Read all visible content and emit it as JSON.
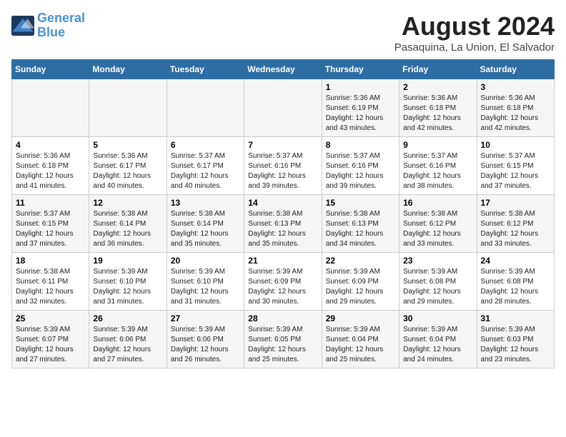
{
  "header": {
    "logo_line1": "General",
    "logo_line2": "Blue",
    "month_year": "August 2024",
    "location": "Pasaquina, La Union, El Salvador"
  },
  "days_of_week": [
    "Sunday",
    "Monday",
    "Tuesday",
    "Wednesday",
    "Thursday",
    "Friday",
    "Saturday"
  ],
  "weeks": [
    [
      {
        "day": "",
        "info": ""
      },
      {
        "day": "",
        "info": ""
      },
      {
        "day": "",
        "info": ""
      },
      {
        "day": "",
        "info": ""
      },
      {
        "day": "1",
        "info": "Sunrise: 5:36 AM\nSunset: 6:19 PM\nDaylight: 12 hours\nand 43 minutes."
      },
      {
        "day": "2",
        "info": "Sunrise: 5:36 AM\nSunset: 6:18 PM\nDaylight: 12 hours\nand 42 minutes."
      },
      {
        "day": "3",
        "info": "Sunrise: 5:36 AM\nSunset: 6:18 PM\nDaylight: 12 hours\nand 42 minutes."
      }
    ],
    [
      {
        "day": "4",
        "info": "Sunrise: 5:36 AM\nSunset: 6:18 PM\nDaylight: 12 hours\nand 41 minutes."
      },
      {
        "day": "5",
        "info": "Sunrise: 5:36 AM\nSunset: 6:17 PM\nDaylight: 12 hours\nand 40 minutes."
      },
      {
        "day": "6",
        "info": "Sunrise: 5:37 AM\nSunset: 6:17 PM\nDaylight: 12 hours\nand 40 minutes."
      },
      {
        "day": "7",
        "info": "Sunrise: 5:37 AM\nSunset: 6:16 PM\nDaylight: 12 hours\nand 39 minutes."
      },
      {
        "day": "8",
        "info": "Sunrise: 5:37 AM\nSunset: 6:16 PM\nDaylight: 12 hours\nand 39 minutes."
      },
      {
        "day": "9",
        "info": "Sunrise: 5:37 AM\nSunset: 6:16 PM\nDaylight: 12 hours\nand 38 minutes."
      },
      {
        "day": "10",
        "info": "Sunrise: 5:37 AM\nSunset: 6:15 PM\nDaylight: 12 hours\nand 37 minutes."
      }
    ],
    [
      {
        "day": "11",
        "info": "Sunrise: 5:37 AM\nSunset: 6:15 PM\nDaylight: 12 hours\nand 37 minutes."
      },
      {
        "day": "12",
        "info": "Sunrise: 5:38 AM\nSunset: 6:14 PM\nDaylight: 12 hours\nand 36 minutes."
      },
      {
        "day": "13",
        "info": "Sunrise: 5:38 AM\nSunset: 6:14 PM\nDaylight: 12 hours\nand 35 minutes."
      },
      {
        "day": "14",
        "info": "Sunrise: 5:38 AM\nSunset: 6:13 PM\nDaylight: 12 hours\nand 35 minutes."
      },
      {
        "day": "15",
        "info": "Sunrise: 5:38 AM\nSunset: 6:13 PM\nDaylight: 12 hours\nand 34 minutes."
      },
      {
        "day": "16",
        "info": "Sunrise: 5:38 AM\nSunset: 6:12 PM\nDaylight: 12 hours\nand 33 minutes."
      },
      {
        "day": "17",
        "info": "Sunrise: 5:38 AM\nSunset: 6:12 PM\nDaylight: 12 hours\nand 33 minutes."
      }
    ],
    [
      {
        "day": "18",
        "info": "Sunrise: 5:38 AM\nSunset: 6:11 PM\nDaylight: 12 hours\nand 32 minutes."
      },
      {
        "day": "19",
        "info": "Sunrise: 5:39 AM\nSunset: 6:10 PM\nDaylight: 12 hours\nand 31 minutes."
      },
      {
        "day": "20",
        "info": "Sunrise: 5:39 AM\nSunset: 6:10 PM\nDaylight: 12 hours\nand 31 minutes."
      },
      {
        "day": "21",
        "info": "Sunrise: 5:39 AM\nSunset: 6:09 PM\nDaylight: 12 hours\nand 30 minutes."
      },
      {
        "day": "22",
        "info": "Sunrise: 5:39 AM\nSunset: 6:09 PM\nDaylight: 12 hours\nand 29 minutes."
      },
      {
        "day": "23",
        "info": "Sunrise: 5:39 AM\nSunset: 6:08 PM\nDaylight: 12 hours\nand 29 minutes."
      },
      {
        "day": "24",
        "info": "Sunrise: 5:39 AM\nSunset: 6:08 PM\nDaylight: 12 hours\nand 28 minutes."
      }
    ],
    [
      {
        "day": "25",
        "info": "Sunrise: 5:39 AM\nSunset: 6:07 PM\nDaylight: 12 hours\nand 27 minutes."
      },
      {
        "day": "26",
        "info": "Sunrise: 5:39 AM\nSunset: 6:06 PM\nDaylight: 12 hours\nand 27 minutes."
      },
      {
        "day": "27",
        "info": "Sunrise: 5:39 AM\nSunset: 6:06 PM\nDaylight: 12 hours\nand 26 minutes."
      },
      {
        "day": "28",
        "info": "Sunrise: 5:39 AM\nSunset: 6:05 PM\nDaylight: 12 hours\nand 25 minutes."
      },
      {
        "day": "29",
        "info": "Sunrise: 5:39 AM\nSunset: 6:04 PM\nDaylight: 12 hours\nand 25 minutes."
      },
      {
        "day": "30",
        "info": "Sunrise: 5:39 AM\nSunset: 6:04 PM\nDaylight: 12 hours\nand 24 minutes."
      },
      {
        "day": "31",
        "info": "Sunrise: 5:39 AM\nSunset: 6:03 PM\nDaylight: 12 hours\nand 23 minutes."
      }
    ]
  ]
}
